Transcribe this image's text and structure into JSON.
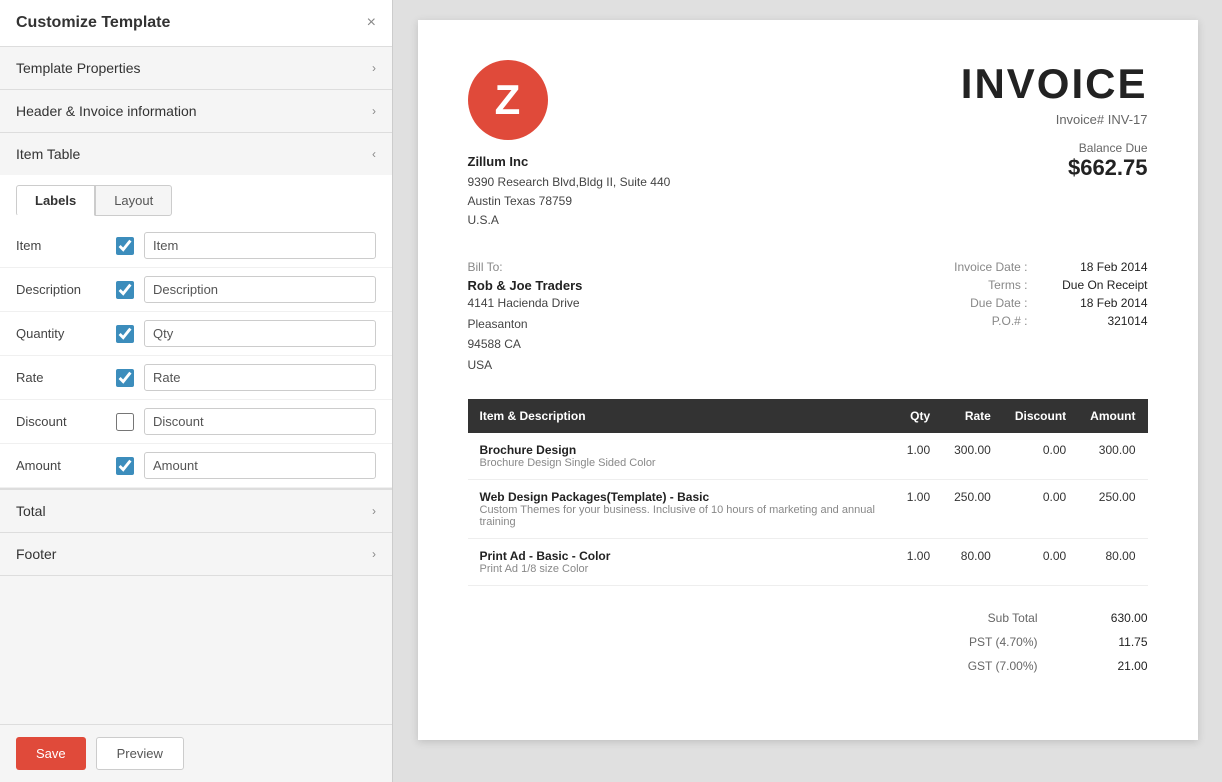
{
  "leftPanel": {
    "title": "Customize Template",
    "closeLabel": "×",
    "sections": {
      "templateProperties": {
        "label": "Template Properties",
        "open": false
      },
      "headerInvoice": {
        "label": "Header & Invoice information",
        "open": false
      },
      "itemTable": {
        "label": "Item Table",
        "open": true,
        "tabs": [
          "Labels",
          "Layout"
        ],
        "activeTab": "Labels",
        "fields": [
          {
            "id": "item",
            "label": "Item",
            "checked": true,
            "value": "Item"
          },
          {
            "id": "description",
            "label": "Description",
            "checked": true,
            "value": "Description"
          },
          {
            "id": "quantity",
            "label": "Quantity",
            "checked": true,
            "value": "Qty"
          },
          {
            "id": "rate",
            "label": "Rate",
            "checked": true,
            "value": "Rate"
          },
          {
            "id": "discount",
            "label": "Discount",
            "checked": false,
            "value": "Discount"
          },
          {
            "id": "amount",
            "label": "Amount",
            "checked": true,
            "value": "Amount"
          }
        ]
      },
      "total": {
        "label": "Total",
        "open": false
      },
      "footer": {
        "label": "Footer",
        "open": false
      }
    },
    "buttons": {
      "save": "Save",
      "preview": "Preview"
    }
  },
  "invoice": {
    "logo": "Z",
    "company": {
      "name": "Zillum Inc",
      "address1": "9390 Research Blvd,Bldg II, Suite 440",
      "address2": "Austin Texas 78759",
      "country": "U.S.A"
    },
    "title": "INVOICE",
    "invoiceNumber": "Invoice# INV-17",
    "balanceLabel": "Balance Due",
    "balanceAmount": "$662.75",
    "billTo": {
      "label": "Bill To:",
      "name": "Rob & Joe Traders",
      "address1": "4141 Hacienda Drive",
      "address2": "Pleasanton",
      "address3": "94588 CA",
      "country": "USA"
    },
    "meta": [
      {
        "key": "Invoice Date :",
        "value": "18 Feb 2014"
      },
      {
        "key": "Terms :",
        "value": "Due On Receipt"
      },
      {
        "key": "Due Date :",
        "value": "18 Feb 2014"
      },
      {
        "key": "P.O.# :",
        "value": "321014"
      }
    ],
    "tableHeaders": [
      "Item & Description",
      "Qty",
      "Rate",
      "Discount",
      "Amount"
    ],
    "items": [
      {
        "name": "Brochure Design",
        "description": "Brochure Design Single Sided Color",
        "qty": "1.00",
        "rate": "300.00",
        "discount": "0.00",
        "amount": "300.00"
      },
      {
        "name": "Web Design Packages(Template) - Basic",
        "description": "Custom Themes for your business. Inclusive of 10 hours of marketing and annual training",
        "qty": "1.00",
        "rate": "250.00",
        "discount": "0.00",
        "amount": "250.00"
      },
      {
        "name": "Print Ad - Basic - Color",
        "description": "Print Ad 1/8 size Color",
        "qty": "1.00",
        "rate": "80.00",
        "discount": "0.00",
        "amount": "80.00"
      }
    ],
    "totals": [
      {
        "key": "Sub Total",
        "value": "630.00"
      },
      {
        "key": "PST (4.70%)",
        "value": "11.75"
      },
      {
        "key": "GST (7.00%)",
        "value": "21.00"
      }
    ]
  }
}
